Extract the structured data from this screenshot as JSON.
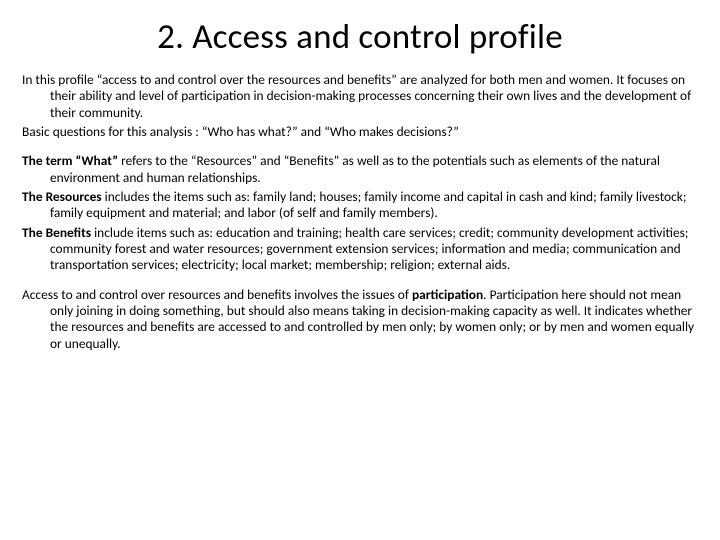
{
  "title": "2. Access and control profile",
  "paragraphs": {
    "p1": "In this profile  “access to and control over the resources and benefits” are analyzed for both men and women. It focuses on their ability and level of participation in decision-making processes concerning their own lives and the development of their community.",
    "p2": "Basic questions for this analysis : “Who has what?” and “Who makes decisions?”",
    "p3_lead": "The term “What”",
    "p3_rest": " refers to the “Resources” and “Benefits” as well as to the potentials such as elements of the natural environment and human relationships.",
    "p4_lead": "The Resources",
    "p4_rest": " includes the items such as: family land; houses; family income and capital in cash and kind; family livestock; family equipment and material; and labor (of self and family members).",
    "p5_lead": "The Benefits",
    "p5_rest": " include items such as: education and training; health care services; credit; community development activities; community forest and water resources; government extension services; information and media; communication and transportation services; electricity; local market; membership; religion; external aids.",
    "p6_a": "Access to and control over resources and benefits involves the issues of ",
    "p6_b": "participation",
    "p6_c": ". Participation here should not mean only joining in doing something, but should also means taking in decision-making capacity as well.  It indicates whether the resources and benefits are accessed to and controlled by men only; by women only; or by men and women equally or unequally."
  }
}
